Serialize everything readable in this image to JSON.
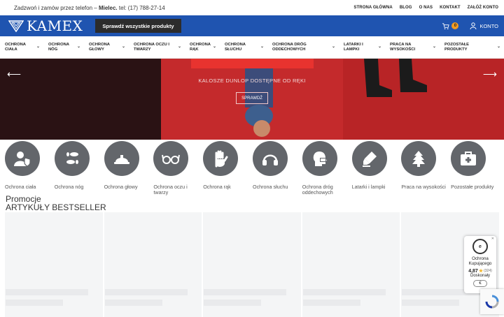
{
  "topbar": {
    "phone_prefix": "Zadzwoń i zamów przez telefon –",
    "phone_city": "Mielec.",
    "phone_number": "tel: (17) 788-27-14",
    "links": [
      "STRONA GŁÓWNA",
      "BLOG",
      "O NAS",
      "KONTAKT",
      "ZAŁÓŻ KONTO"
    ]
  },
  "header": {
    "logo_text": "KAMEX",
    "all_products_button": "Sprawdź wszystkie produkty",
    "cart_count": "0",
    "account_label": "KONTO",
    "colors": {
      "brand_blue": "#1f54b0",
      "accent_orange": "#f29b21"
    }
  },
  "catnav": [
    "OCHRONA CIAŁA",
    "OCHRONA NÓG",
    "OCHRONA GŁOWY",
    "OCHRONA OCZU I TWARZY",
    "OCHRONA RĄK",
    "OCHRONA SŁUCHU",
    "OCHRONA DRÓG ODDECHOWYCH",
    "LATARKI I LAMPKI",
    "PRACA NA WYSOKOŚCI",
    "POZOSTAŁE PRODUKTY"
  ],
  "hero": {
    "caption": "KALOSZE DUNLOP DOSTĘPNE OD RĘKI",
    "button": "SPRAWDŹ",
    "prev_icon": "arrow-left-icon",
    "next_icon": "arrow-right-icon"
  },
  "categories": [
    {
      "label": "Ochrona ciała",
      "icon": "body-shield-icon"
    },
    {
      "label": "Ochrona nóg",
      "icon": "footprints-icon"
    },
    {
      "label": "Ochrona głowy",
      "icon": "hard-hat-icon"
    },
    {
      "label": "Ochrona oczu i twarzy",
      "icon": "glasses-icon"
    },
    {
      "label": "Ochrona rąk",
      "icon": "hand-icon"
    },
    {
      "label": "Ochrona słuchu",
      "icon": "headphones-icon"
    },
    {
      "label": "Ochrona dróg oddechowych",
      "icon": "head-mask-icon"
    },
    {
      "label": "Latarki i lampki",
      "icon": "highlighter-icon"
    },
    {
      "label": "Praca na wysokości",
      "icon": "tree-icon"
    },
    {
      "label": "Pozostałe produkty",
      "icon": "first-aid-icon"
    }
  ],
  "sections": {
    "promo_title": "Promocje",
    "bestseller_title": "ARTYKUŁY BESTSELLER"
  },
  "trust_badge": {
    "title": "Ochrona Kupującego",
    "score": "4,87",
    "count": "(324)",
    "rating_text": "Doskonały",
    "chip": "€"
  }
}
